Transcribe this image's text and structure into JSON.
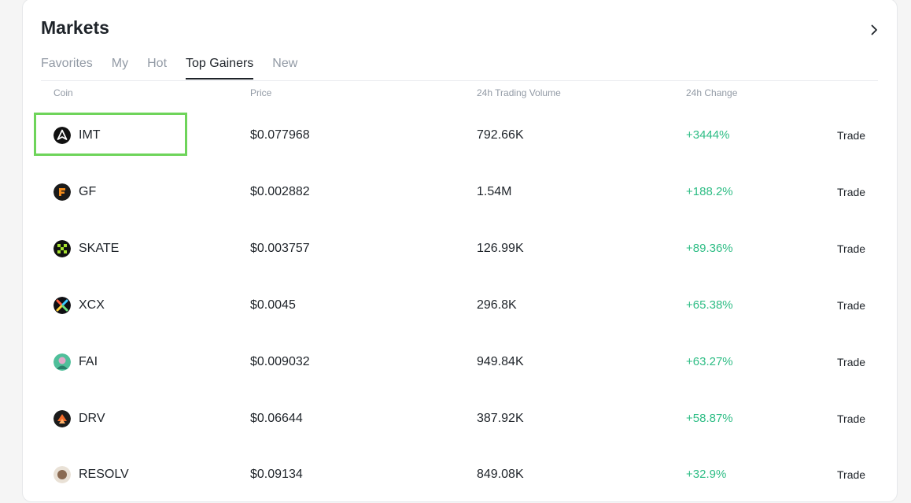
{
  "header": {
    "title": "Markets"
  },
  "tabs": [
    {
      "label": "Favorites",
      "active": false
    },
    {
      "label": "My",
      "active": false
    },
    {
      "label": "Hot",
      "active": false
    },
    {
      "label": "Top Gainers",
      "active": true
    },
    {
      "label": "New",
      "active": false
    }
  ],
  "columns": {
    "coin": "Coin",
    "price": "Price",
    "volume": "24h Trading Volume",
    "change": "24h Change"
  },
  "rows": [
    {
      "symbol": "IMT",
      "price": "$0.077968",
      "volume": "792.66K",
      "change": "+3444%",
      "action": "Trade",
      "icon": "imt-coin-icon"
    },
    {
      "symbol": "GF",
      "price": "$0.002882",
      "volume": "1.54M",
      "change": "+188.2%",
      "action": "Trade",
      "icon": "gf-coin-icon"
    },
    {
      "symbol": "SKATE",
      "price": "$0.003757",
      "volume": "126.99K",
      "change": "+89.36%",
      "action": "Trade",
      "icon": "skate-coin-icon"
    },
    {
      "symbol": "XCX",
      "price": "$0.0045",
      "volume": "296.8K",
      "change": "+65.38%",
      "action": "Trade",
      "icon": "xcx-coin-icon"
    },
    {
      "symbol": "FAI",
      "price": "$0.009032",
      "volume": "949.84K",
      "change": "+63.27%",
      "action": "Trade",
      "icon": "fai-coin-icon"
    },
    {
      "symbol": "DRV",
      "price": "$0.06644",
      "volume": "387.92K",
      "change": "+58.87%",
      "action": "Trade",
      "icon": "drv-coin-icon"
    },
    {
      "symbol": "RESOLV",
      "price": "$0.09134",
      "volume": "849.08K",
      "change": "+32.9%",
      "action": "Trade",
      "icon": "resolv-coin-icon"
    }
  ],
  "colors": {
    "positive": "#2ebd85",
    "text": "#1e2329",
    "muted": "#929aa5",
    "highlight": "#6ed45a"
  }
}
